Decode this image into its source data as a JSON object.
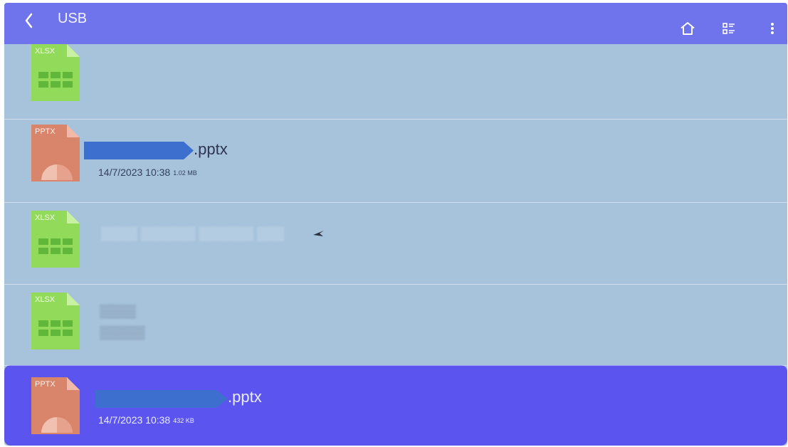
{
  "header": {
    "title": "USB",
    "back_icon": "chevron-left-icon",
    "home_icon": "home-icon",
    "view_icon": "list-view-icon",
    "more_icon": "more-vertical-icon"
  },
  "files": [
    {
      "type_label": "XLSX",
      "name": "",
      "meta": ""
    },
    {
      "type_label": "PPTX",
      "name": ".pptx",
      "date": "14/7/2023 10:38",
      "size": "1.02 MB"
    },
    {
      "type_label": "XLSX",
      "name": "",
      "meta": ""
    },
    {
      "type_label": "XLSX",
      "name": "",
      "meta": ""
    },
    {
      "type_label": "PPTX",
      "name": ".pptx",
      "date": "14/7/2023 10:38",
      "size": "432 KB"
    }
  ],
  "colors": {
    "header": "#6f73ec",
    "background": "#a7c3dc",
    "selected_row": "#5c54ef",
    "xlsx_icon": "#92da59",
    "pptx_icon": "#d9856b",
    "redaction": "#3d6fcf"
  }
}
